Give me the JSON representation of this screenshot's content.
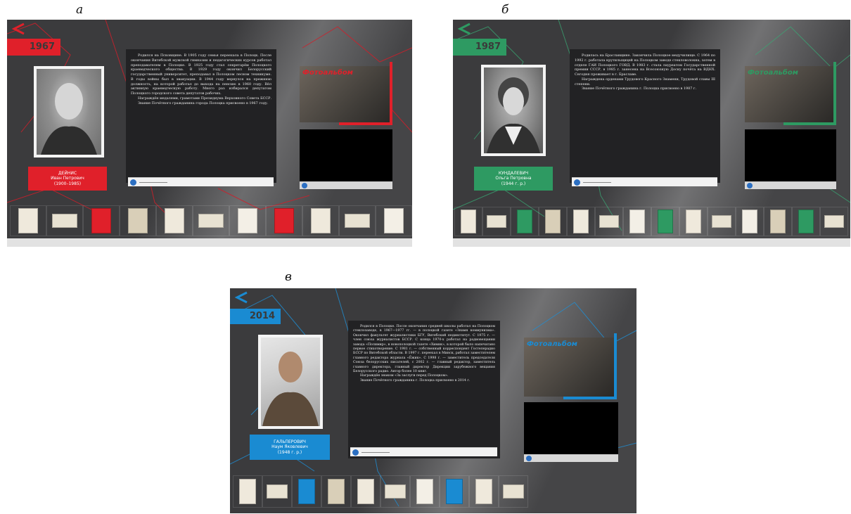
{
  "figure_labels": {
    "a": "а",
    "b": "б",
    "c": "в"
  },
  "album_label": "Фотоальбом",
  "panels": [
    {
      "accent": "#e0202a",
      "year": "1967",
      "name_lines": [
        "ДЕЙНИС",
        "Иван Петрович",
        "(1900–1985)"
      ],
      "bio": [
        "Родился на Псковщине. В 1905 году семья переехала в Полоцк. После окончания Витебской мужской гимназии и педагогических курсов работал преподавателем в Полоцке. В 1925 году стал секретарём Полоцкого краеведческого общества. В 1929 году окончил Белорусский государственный университет, преподавал в Полоцком лесном техникуме. В годы войны был в эвакуации. В 1944 году вернулся на прежнюю должность, на которой работал до выхода на пенсию в 1960 году. Вёл активную краеведческую работу. Много раз избирался депутатом Полоцкого городского совета депутатов рабочих.",
        "Награждён медалями, грамотами Президиума Верховного Совета БССР.",
        "Звание Почётного гражданина города Полоцка присвоено в 1967 году."
      ],
      "thumb_count": 11
    },
    {
      "accent": "#2e9a62",
      "year": "1987",
      "name_lines": [
        "КУНДАЛЕВИЧ",
        "Ольга Петровна",
        "(1944 г. р.)"
      ],
      "bio": [
        "Родилась на Браславщине. Закончила Полоцкое медучилище. С 1964 по 1992 г. работала крутильщицей на Полоцком заводе стекловолокна, затем в отделе ГАИ Полоцкого ГОВД. В 1983 г. стала лауреатом Государственной премии СССР, в 1985 г. занесена на Всесоюзную Доску почёта на ВДНХ. Сегодня проживает в г. Браславе.",
        "Награждена орденами Трудового Красного Знамени, Трудовой славы III степени.",
        "Звание Почётного гражданина г. Полоцка присвоено в 1987 г."
      ],
      "thumb_count": 14
    },
    {
      "accent": "#1a8bd2",
      "year": "2014",
      "name_lines": [
        "ГАЛЬПЕРОВИЧ",
        "Наум Яковлевич",
        "(1948 г. р.)"
      ],
      "bio": [
        "Родился в Полоцке. После окончания средней школы работал на Полоцком стеклозаводе, в 1967—1977 гг. — в полоцкой газете «Знамя коммунизма». Окончил факультет журналистики БГУ, Витебский пединститут. С 1975 г. — член союза журналистов БССР. С конца 1970-х работал на радиовещании завода «Полимир», в новополоцкой газете «Химик», в которой было напечатано первое стихотворение. С 1981 г. — собственный корреспондент Гостелерадио БССР по Витебской области. В 1997 г. переехал в Минск, работал заместителем главного редактора журнала «Ёжик». С 1998 г. — заместитель председателя Союза белорусских писателей, с 2002 г. — главный редактор, заместитель главного директора, главный директор Дирекции зарубежного вещания Белорусского радио. Автор более 10 книг.",
        "Награждён знаком «За заслуги перед Полоцком».",
        "Звание Почётного гражданина г. Полоцка присвоено в 2014 г."
      ],
      "thumb_count": 10
    }
  ],
  "icons": {
    "back": "chevron-left-icon",
    "play": "play-icon",
    "thumb": "document-icon"
  }
}
